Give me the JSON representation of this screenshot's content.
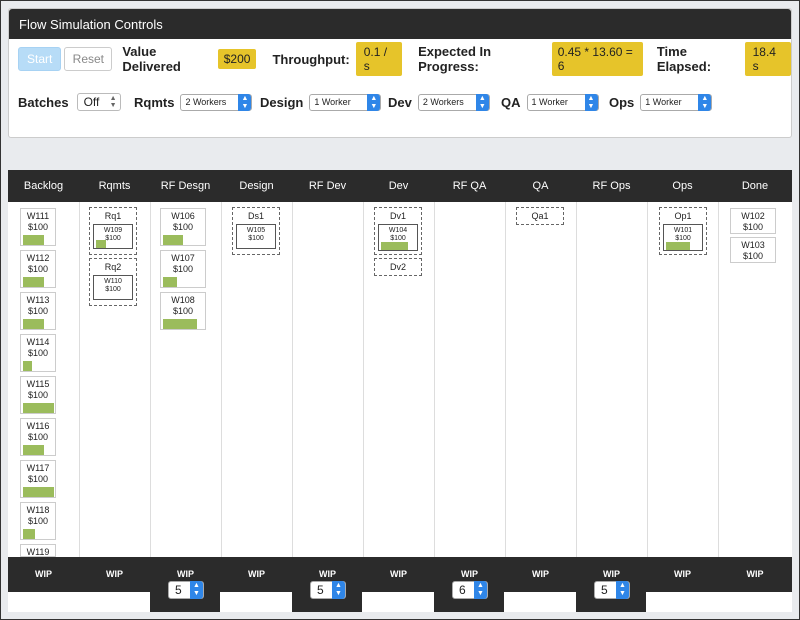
{
  "panel": {
    "title": "Flow Simulation Controls",
    "start_label": "Start",
    "reset_label": "Reset",
    "value_delivered_label": "Value Delivered",
    "value_delivered": "$200",
    "throughput_label": "Throughput:",
    "throughput": "0.1 / s",
    "expected_label": "Expected In Progress:",
    "expected": "0.45 * 13.60 = 6",
    "time_label": "Time Elapsed:",
    "time": "18.4 s",
    "batches_label": "Batches",
    "batches_value": "Off",
    "workers": [
      {
        "label": "Rqmts",
        "value": "2 Workers"
      },
      {
        "label": "Design",
        "value": "1 Worker"
      },
      {
        "label": "Dev",
        "value": "2 Workers"
      },
      {
        "label": "QA",
        "value": "1 Worker"
      },
      {
        "label": "Ops",
        "value": "1 Worker"
      }
    ]
  },
  "columns": [
    "Backlog",
    "Rqmts",
    "RF Desgn",
    "Design",
    "RF Dev",
    "Dev",
    "RF QA",
    "QA",
    "RF Ops",
    "Ops",
    "Done"
  ],
  "wip_label": "WIP",
  "wip_limits": [
    "5",
    "5",
    "6",
    "5"
  ],
  "backlog": [
    {
      "id": "W111",
      "value": "$100",
      "progress": 0.7
    },
    {
      "id": "W112",
      "value": "$100",
      "progress": 0.7
    },
    {
      "id": "W113",
      "value": "$100",
      "progress": 0.7
    },
    {
      "id": "W114",
      "value": "$100",
      "progress": 0.3
    },
    {
      "id": "W115",
      "value": "$100",
      "progress": 1.0
    },
    {
      "id": "W116",
      "value": "$100",
      "progress": 0.7
    },
    {
      "id": "W117",
      "value": "$100",
      "progress": 1.0
    },
    {
      "id": "W118",
      "value": "$100",
      "progress": 0.4
    },
    {
      "id": "W119",
      "value": "",
      "progress": 0
    }
  ],
  "rqmts": [
    {
      "group": "Rq1",
      "item": "W109",
      "value": "$100",
      "progress": 0.3
    },
    {
      "group": "Rq2",
      "item": "W110",
      "value": "$100",
      "progress": 0
    }
  ],
  "rf_design": [
    {
      "id": "W106",
      "value": "$100",
      "progress": 0.5
    },
    {
      "id": "W107",
      "value": "$100",
      "progress": 0.35
    },
    {
      "id": "W108",
      "value": "$100",
      "progress": 0.85
    }
  ],
  "design": [
    {
      "group": "Ds1",
      "item": "W105",
      "value": "$100",
      "progress": 0
    }
  ],
  "dev": [
    {
      "group": "Dv1",
      "item": "W104",
      "value": "$100",
      "progress": 0.8
    },
    {
      "group": "Dv2",
      "item": "",
      "value": "",
      "progress": 0
    }
  ],
  "qa": [
    {
      "group": "Qa1",
      "item": "",
      "value": "",
      "progress": 0
    }
  ],
  "ops": [
    {
      "group": "Op1",
      "item": "W101",
      "value": "$100",
      "progress": 0.7
    }
  ],
  "done": [
    {
      "id": "W102",
      "value": "$100"
    },
    {
      "id": "W103",
      "value": "$100"
    }
  ],
  "colors": {
    "accent": "#2f86e8",
    "highlight": "#e6c42a",
    "progress": "#9bbc5c",
    "header": "#2b2b2b"
  }
}
